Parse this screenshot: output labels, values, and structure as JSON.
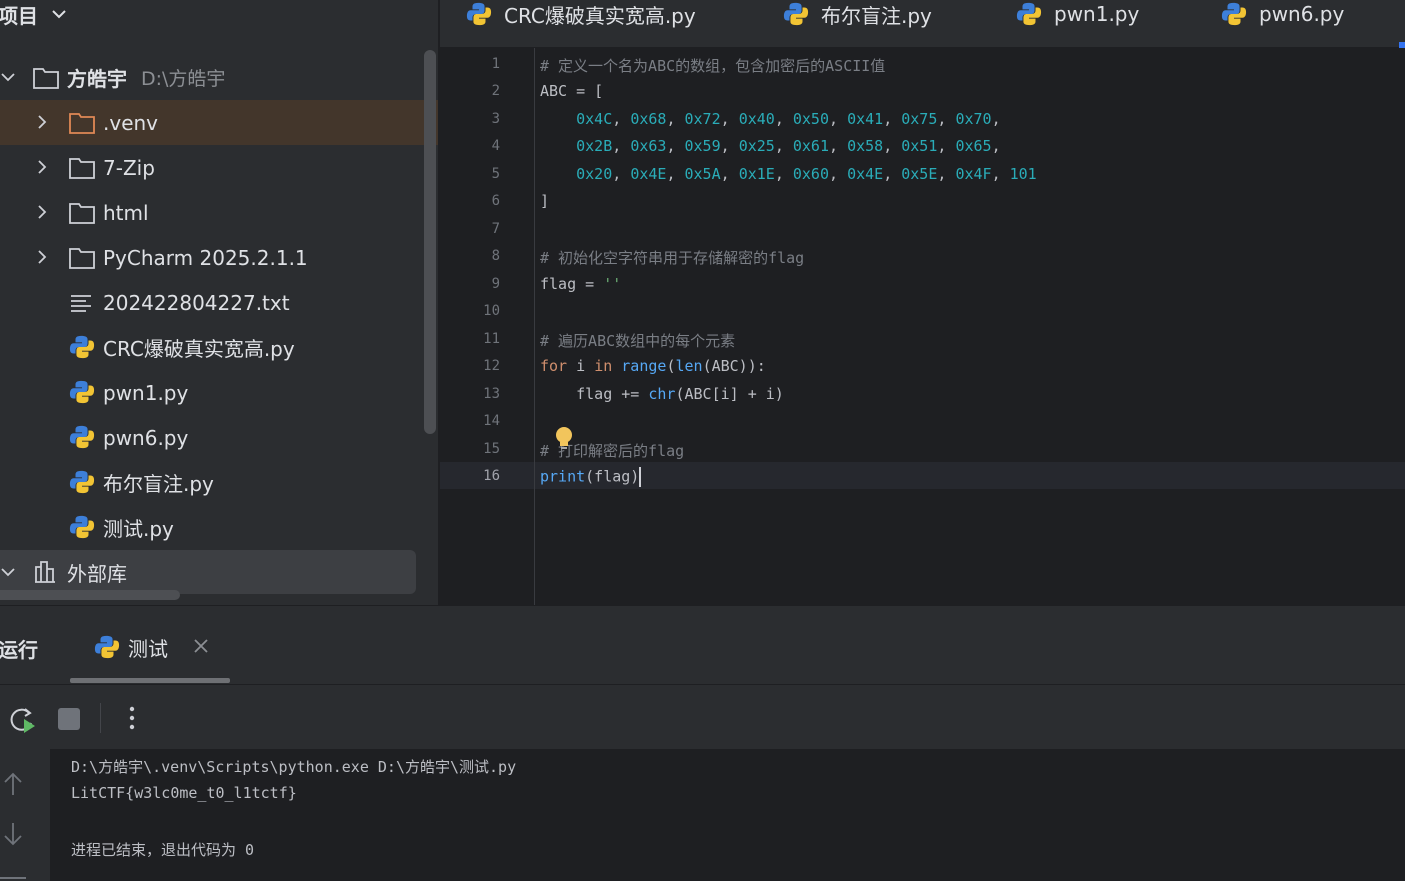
{
  "project_panel": {
    "title": "项目",
    "root": {
      "name": "方皓宇",
      "path": "D:\\方皓宇"
    },
    "items": [
      {
        "label": ".venv",
        "type": "folder-excluded",
        "expandable": true
      },
      {
        "label": "7-Zip",
        "type": "folder",
        "expandable": true
      },
      {
        "label": "html",
        "type": "folder",
        "expandable": true
      },
      {
        "label": "PyCharm 2025.2.1.1",
        "type": "folder",
        "expandable": true
      },
      {
        "label": "202422804227.txt",
        "type": "text-file",
        "expandable": false
      },
      {
        "label": "CRC爆破真实宽高.py",
        "type": "python-file",
        "expandable": false
      },
      {
        "label": "pwn1.py",
        "type": "python-file",
        "expandable": false
      },
      {
        "label": "pwn6.py",
        "type": "python-file",
        "expandable": false
      },
      {
        "label": "布尔盲注.py",
        "type": "python-file",
        "expandable": false
      },
      {
        "label": "测试.py",
        "type": "python-file",
        "expandable": false
      }
    ],
    "external_libraries": "外部库"
  },
  "editor_tabs": [
    {
      "label": "CRC爆破真实宽高.py"
    },
    {
      "label": "布尔盲注.py"
    },
    {
      "label": "pwn1.py"
    },
    {
      "label": "pwn6.py"
    }
  ],
  "editor": {
    "current_line": 16,
    "line_numbers": [
      "1",
      "2",
      "3",
      "4",
      "5",
      "6",
      "7",
      "8",
      "9",
      "10",
      "11",
      "12",
      "13",
      "14",
      "15",
      "16"
    ],
    "lines": {
      "l1": "# 定义一个名为ABC的数组，包含加密后的ASCII值",
      "l2": "ABC = [",
      "l3_vals": [
        "0x4C",
        "0x68",
        "0x72",
        "0x40",
        "0x50",
        "0x41",
        "0x75",
        "0x70"
      ],
      "l4_vals": [
        "0x2B",
        "0x63",
        "0x59",
        "0x25",
        "0x61",
        "0x58",
        "0x51",
        "0x65"
      ],
      "l5_vals": [
        "0x20",
        "0x4E",
        "0x5A",
        "0x1E",
        "0x60",
        "0x4E",
        "0x5E",
        "0x4F",
        "101"
      ],
      "l6": "]",
      "l8": "# 初始化空字符串用于存储解密的flag",
      "l9_name": "flag = ",
      "l9_val": "''",
      "l11": "# 遍历ABC数组中的每个元素",
      "l12_for": "for",
      "l12_i": " i ",
      "l12_in": "in",
      "l12_range": "range",
      "l12_len": "len",
      "l12_rest": "(ABC)):",
      "l13_pre": "    flag += ",
      "l13_chr": "chr",
      "l13_rest": "(ABC[i] + i)",
      "l15": "# 打印解密后的flag",
      "l16_print": "print",
      "l16_rest": "(flag)"
    }
  },
  "run_panel": {
    "title": "运行",
    "tab_label": "测试",
    "console": [
      "D:\\方皓宇\\.venv\\Scripts\\python.exe D:\\方皓宇\\测试.py",
      "LitCTF{w3lc0me_t0_l1tctf}",
      "",
      "进程已结束，退出代码为 0"
    ]
  },
  "colors": {
    "accent": "#3574f0",
    "comment": "#7a7e85",
    "keyword": "#cf8e6d",
    "number": "#2aacb8",
    "function": "#56a8f5",
    "string": "#6aab73"
  }
}
